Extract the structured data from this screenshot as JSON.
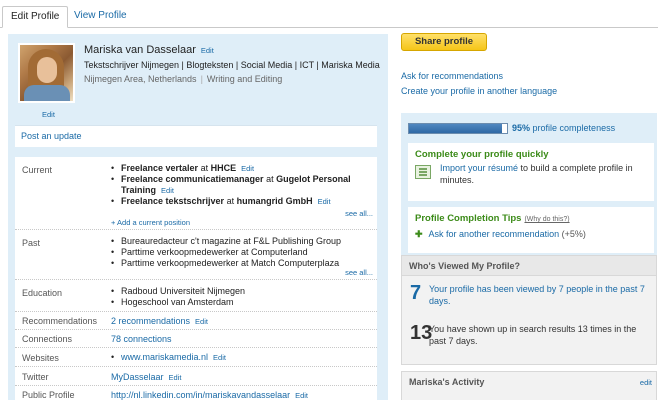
{
  "tabs": [
    {
      "label": "Edit Profile",
      "active": true
    },
    {
      "label": "View Profile",
      "active": false
    }
  ],
  "profile": {
    "name": "Mariska van Dasselaar",
    "name_edit": "Edit",
    "photo_edit": "Edit",
    "headline": "Tekstschrijver Nijmegen | Blogteksten | Social Media | ICT | Mariska Media",
    "location": "Nijmegen Area, Netherlands",
    "industry": "Writing and Editing"
  },
  "post_update": "Post an update",
  "sections": {
    "current": {
      "label": "Current",
      "items": [
        {
          "title": "Freelance vertaler",
          "at": "at",
          "company": "HHCE",
          "edit": "Edit"
        },
        {
          "title": "Freelance communicatiemanager",
          "at": "at",
          "company": "Gugelot Personal Training",
          "edit": "Edit"
        },
        {
          "title": "Freelance tekstschrijver",
          "at": "at",
          "company": "humangrid GmbH",
          "edit": "Edit"
        }
      ],
      "add": "+ Add a current position",
      "see_all": "see all..."
    },
    "past": {
      "label": "Past",
      "items": [
        "Bureauredacteur c't magazine at F&L Publishing Group",
        "Parttime verkoopmedewerker at Computerland",
        "Parttime verkoopmedewerker at Match Computerplaza"
      ],
      "see_all": "see all..."
    },
    "education": {
      "label": "Education",
      "items": [
        "Radboud Universiteit Nijmegen",
        "Hogeschool van Amsterdam"
      ]
    },
    "recommendations": {
      "label": "Recommendations",
      "value": "2 recommendations",
      "edit": "Edit"
    },
    "connections": {
      "label": "Connections",
      "value": "78 connections"
    },
    "websites": {
      "label": "Websites",
      "value": "www.mariskamedia.nl",
      "edit": "Edit"
    },
    "twitter": {
      "label": "Twitter",
      "value": "MyDasselaar",
      "edit": "Edit"
    },
    "public_profile": {
      "label": "Public Profile",
      "value": "http://nl.linkedin.com/in/mariskavandasselaar",
      "edit": "Edit"
    }
  },
  "right": {
    "share_button": "Share profile",
    "ask_recommendations": "Ask for recommendations",
    "create_language": "Create your profile in another language",
    "completeness": {
      "percent": 95,
      "percent_text": "95%",
      "label": "profile completeness",
      "quick_title": "Complete your profile quickly",
      "import_link": "Import your résumé",
      "import_rest": "to build a complete profile in minutes.",
      "tips_title": "Profile Completion Tips",
      "tips_why": "(Why do this?)",
      "tip_link": "Ask for another recommendation",
      "tip_gain": "(+5%)"
    },
    "viewed": {
      "title": "Who's Viewed My Profile?",
      "views_num": "7",
      "views_text": "Your profile has been viewed by 7 people in the past 7 days.",
      "search_num": "13",
      "search_text": "You have shown up in search results 13 times in the past 7 days."
    },
    "activity": {
      "title": "Mariska's Activity",
      "edit": "edit"
    }
  }
}
